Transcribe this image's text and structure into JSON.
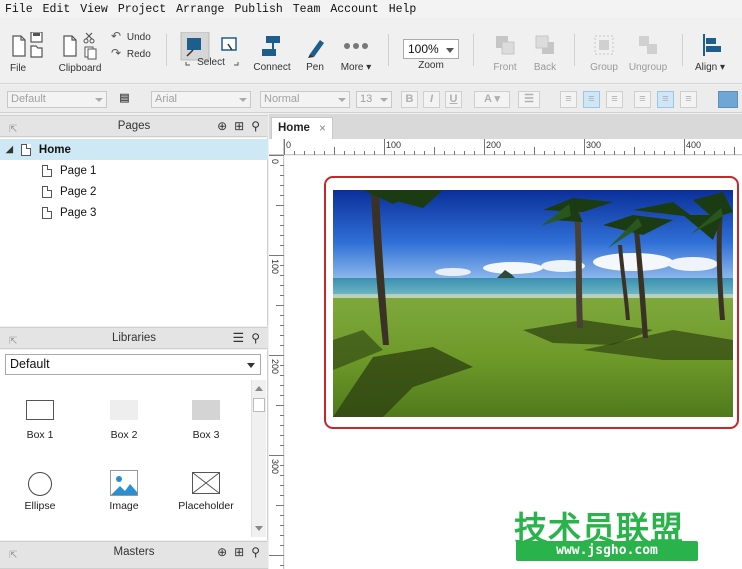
{
  "menu": [
    "File",
    "Edit",
    "View",
    "Project",
    "Arrange",
    "Publish",
    "Team",
    "Account",
    "Help"
  ],
  "toolbar": {
    "file": "File",
    "clipboard": "Clipboard",
    "undo": "Undo",
    "redo": "Redo",
    "select": "Select",
    "connect": "Connect",
    "pen": "Pen",
    "more": "More ▾",
    "zoom_value": "100%",
    "zoom": "Zoom",
    "front": "Front",
    "back": "Back",
    "group": "Group",
    "ungroup": "Ungroup",
    "align": "Align ▾"
  },
  "format": {
    "style": "Default",
    "font": "Arial",
    "weight": "Normal",
    "size": "13",
    "bold": "B",
    "italic": "I",
    "underline": "U",
    "font_color": "A"
  },
  "pages": {
    "title": "Pages",
    "items": [
      {
        "label": "Home",
        "selected": true
      },
      {
        "label": "Page 1"
      },
      {
        "label": "Page 2"
      },
      {
        "label": "Page 3"
      }
    ]
  },
  "libraries": {
    "title": "Libraries",
    "selected": "Default",
    "widgets": [
      {
        "label": "Box 1"
      },
      {
        "label": "Box 2"
      },
      {
        "label": "Box 3"
      },
      {
        "label": "Ellipse"
      },
      {
        "label": "Image"
      },
      {
        "label": "Placeholder"
      }
    ]
  },
  "masters": {
    "title": "Masters"
  },
  "canvas": {
    "tab": "Home",
    "ruler_top": [
      "0",
      "100",
      "200",
      "300",
      "400"
    ],
    "ruler_left": [
      "0",
      "100",
      "200",
      "300"
    ]
  },
  "watermark": {
    "title": "技术员联盟",
    "url": "www.jsgho.com"
  },
  "colors": {
    "selection": "#c9262a",
    "page_selected": "#cfe8f6",
    "watermark_green": "#29b34a"
  }
}
